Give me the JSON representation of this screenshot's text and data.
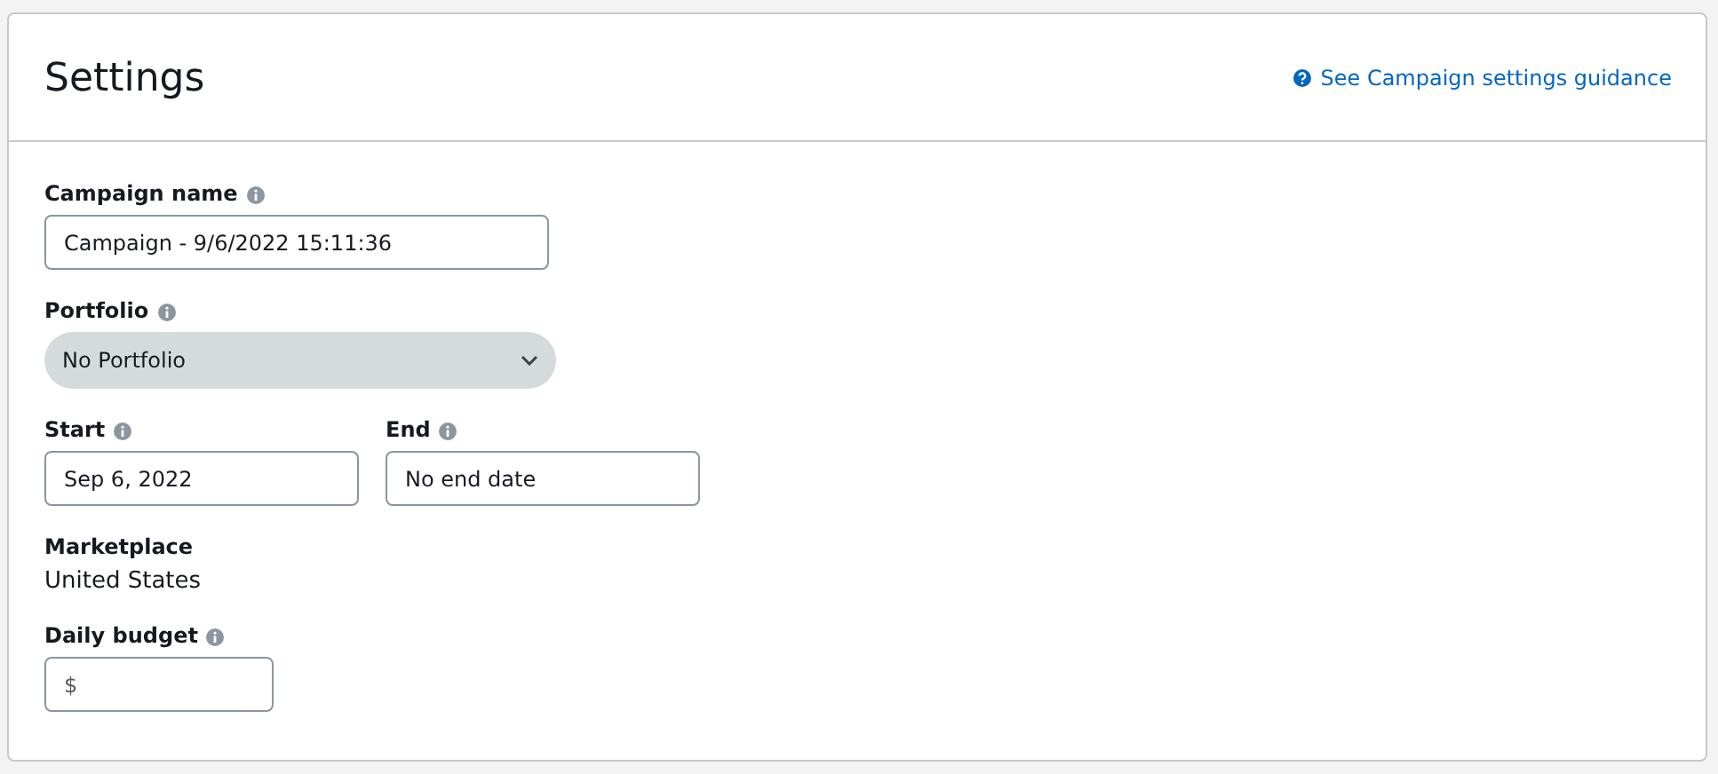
{
  "header": {
    "title": "Settings",
    "help_link": "See Campaign settings guidance"
  },
  "fields": [
    {
      "kind": "text",
      "label": "Campaign name",
      "info": true,
      "value": "Campaign - 9/6/2022 15:11:36"
    },
    {
      "kind": "select",
      "label": "Portfolio",
      "info": true,
      "value": "No Portfolio"
    },
    {
      "kind": "pair",
      "items": [
        {
          "label": "Start",
          "info": true,
          "value": "Sep 6, 2022"
        },
        {
          "label": "End",
          "info": true,
          "value": "No end date"
        }
      ]
    },
    {
      "kind": "static",
      "label": "Marketplace",
      "info": false,
      "value": "United States"
    },
    {
      "kind": "currency",
      "label": "Daily budget",
      "info": true,
      "prefix": "$"
    }
  ]
}
